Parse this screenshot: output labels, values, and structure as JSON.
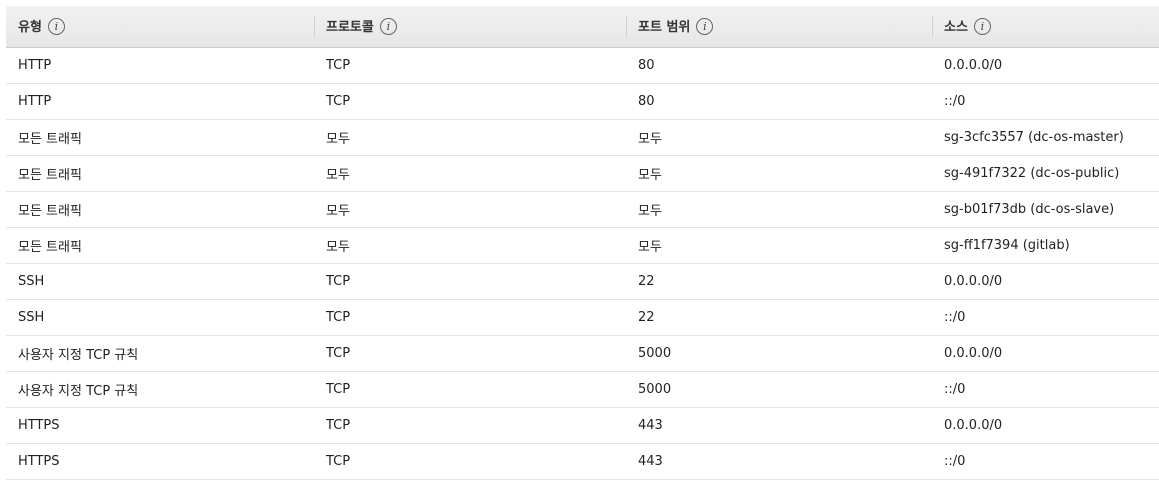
{
  "table": {
    "columns": [
      {
        "label": "유형",
        "info_icon": "info-icon"
      },
      {
        "label": "프로토콜",
        "info_icon": "info-icon"
      },
      {
        "label": "포트 범위",
        "info_icon": "info-icon"
      },
      {
        "label": "소스",
        "info_icon": "info-icon"
      }
    ],
    "rows": [
      [
        "HTTP",
        "TCP",
        "80",
        "0.0.0.0/0"
      ],
      [
        "HTTP",
        "TCP",
        "80",
        "::/0"
      ],
      [
        "모든 트래픽",
        "모두",
        "모두",
        "sg-3cfc3557 (dc-os-master)"
      ],
      [
        "모든 트래픽",
        "모두",
        "모두",
        "sg-491f7322 (dc-os-public)"
      ],
      [
        "모든 트래픽",
        "모두",
        "모두",
        "sg-b01f73db (dc-os-slave)"
      ],
      [
        "모든 트래픽",
        "모두",
        "모두",
        "sg-ff1f7394 (gitlab)"
      ],
      [
        "SSH",
        "TCP",
        "22",
        "0.0.0.0/0"
      ],
      [
        "SSH",
        "TCP",
        "22",
        "::/0"
      ],
      [
        "사용자 지정 TCP 규칙",
        "TCP",
        "5000",
        "0.0.0.0/0"
      ],
      [
        "사용자 지정 TCP 규칙",
        "TCP",
        "5000",
        "::/0"
      ],
      [
        "HTTPS",
        "TCP",
        "443",
        "0.0.0.0/0"
      ],
      [
        "HTTPS",
        "TCP",
        "443",
        "::/0"
      ]
    ]
  }
}
